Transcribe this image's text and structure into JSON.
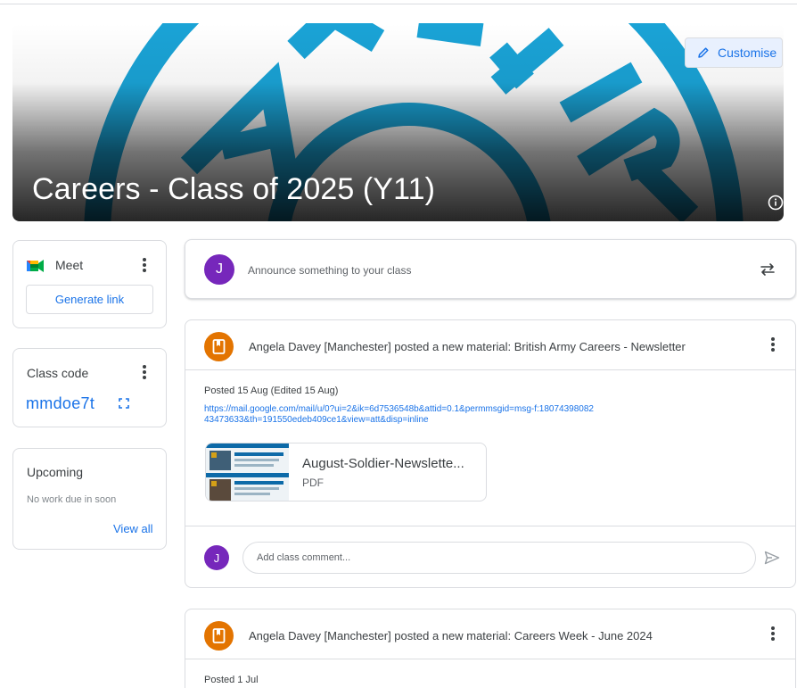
{
  "banner": {
    "title": "Careers - Class of 2025 (Y11)",
    "customise_label": "Customise",
    "accent": "#1aa3d6"
  },
  "meet": {
    "label": "Meet",
    "generate_link_label": "Generate link"
  },
  "class_code": {
    "label": "Class code",
    "value": "mmdoe7t"
  },
  "upcoming": {
    "title": "Upcoming",
    "status": "No work due in soon",
    "view_all_label": "View all"
  },
  "announce": {
    "avatar_letter": "J",
    "placeholder": "Announce something to your class"
  },
  "posts": [
    {
      "title": "Angela Davey [Manchester] posted a new material: British Army Careers - Newsletter",
      "date": "Posted 15 Aug (Edited 15 Aug)",
      "link": "https://mail.google.com/mail/u/0?ui=2&ik=6d7536548b&attid=0.1&permmsgid=msg-f:1807439808243473633&th=191550edeb409ce1&view=att&disp=inline",
      "attachment": {
        "name": "August-Soldier-Newslette...",
        "type": "PDF"
      },
      "comment_avatar_letter": "J",
      "comment_placeholder": "Add class comment..."
    },
    {
      "title": "Angela Davey [Manchester] posted a new material: Careers Week - June 2024",
      "date": "Posted 1 Jul"
    }
  ],
  "colors": {
    "primary": "#1a73e8",
    "avatar_purple": "#7627bb",
    "material_orange": "#e37400"
  }
}
